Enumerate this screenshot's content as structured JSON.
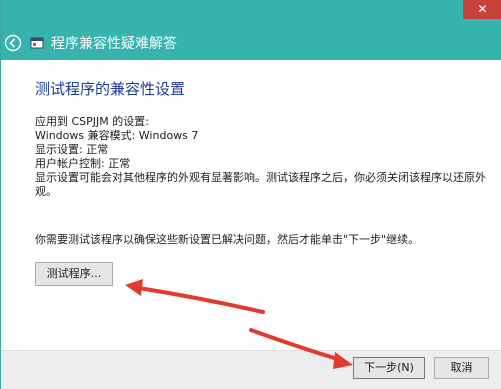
{
  "window": {
    "title": "程序兼容性疑难解答",
    "close_glyph": "✕",
    "titlebar_color": "#36b3ad",
    "close_color": "#c7423a"
  },
  "content": {
    "heading": "测试程序的兼容性设置",
    "lines": [
      "应用到  CSPJJM 的设置:",
      "Windows 兼容模式: Windows 7",
      "显示设置: 正常",
      "用户帐户控制: 正常",
      "显示设置可能会对其他程序的外观有显著影响。测试该程序之后，你必须关闭该程序以还原外",
      "观。"
    ],
    "instruction": "你需要测试该程序以确保这些新设置已解决问题，然后才能单击\"下一步\"继续。",
    "test_button_label": "测试程序..."
  },
  "footer": {
    "next_label": "下一步(N)",
    "cancel_label": "取消"
  },
  "annotations": {
    "arrow_color": "#e23a2e"
  }
}
